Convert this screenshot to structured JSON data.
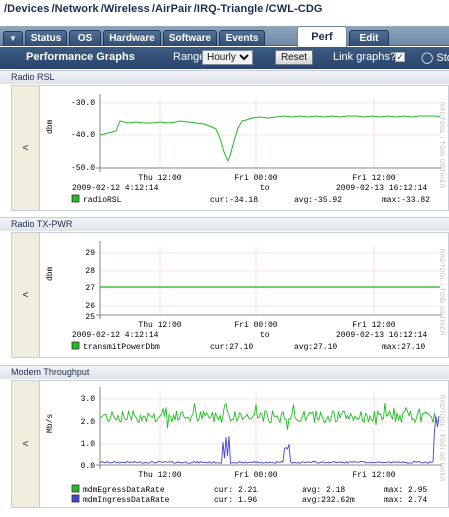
{
  "breadcrumb": [
    "/Devices",
    "/Network",
    "/Wireless",
    "/AirPair",
    "/IRQ-Triangle",
    "/CWL-CDG"
  ],
  "tabs": [
    {
      "label": "Status"
    },
    {
      "label": "OS"
    },
    {
      "label": "Hardware"
    },
    {
      "label": "Software"
    },
    {
      "label": "Events"
    },
    {
      "label": "Perf"
    },
    {
      "label": "Edit"
    }
  ],
  "toolbar": {
    "title": "Performance Graphs",
    "range_label": "Range",
    "range_value": "Hourly",
    "reset_label": "Reset",
    "link_label": "Link graphs?",
    "link_checked": "✓",
    "stop_label": "Sto"
  },
  "collapse_label": "<",
  "panels": [
    {
      "title": "Radio RSL",
      "ylabel": "dbm",
      "yticks": [
        "-30.0",
        "-40.0",
        "-50.0"
      ],
      "xticks": [
        "Thu 12:00",
        "Fri 00:00",
        "Fri 12:00"
      ],
      "start": "2009-02-12 4:12:14",
      "to": "to",
      "end": "2009-02-13 16:12:14",
      "series": [
        {
          "name": "radioRSL",
          "cur": "cur:-34.18",
          "avg": "avg:-35.92",
          "max": "max:-33.82",
          "color": "#22bb22"
        }
      ]
    },
    {
      "title": "Radio TX-PWR",
      "ylabel": "dbm",
      "yticks": [
        "29",
        "28",
        "27",
        "26",
        "25"
      ],
      "xticks": [
        "Thu 12:00",
        "Fri 00:00",
        "Fri 12:00"
      ],
      "start": "2009-02-12 4:12:14",
      "to": "to",
      "end": "2009-02-13 16:12:14",
      "series": [
        {
          "name": "transmitPowerDbm",
          "cur": "cur:27.10",
          "avg": "avg:27.10",
          "max": "max:27.10",
          "color": "#22bb22"
        }
      ]
    },
    {
      "title": "Modem Throughput",
      "ylabel": "Mb/s",
      "yticks": [
        "3.0",
        "2.0",
        "1.0",
        "0.0"
      ],
      "xticks": [
        "Thu 12:00",
        "Fri 00:00",
        "Fri 12:00"
      ],
      "series": [
        {
          "name": "mdmEgressDataRate",
          "cur": "cur: 2.21",
          "avg": "avg: 2.18",
          "max": "max: 2.95",
          "color": "#22bb22"
        },
        {
          "name": "mdmIngressDataRate",
          "cur": "cur: 1.96",
          "avg": "avg:232.62m",
          "max": "max: 2.74",
          "color": "#4444cc"
        }
      ]
    }
  ],
  "watermark": "RRDTOOL / TOBI OETIKER",
  "chart_data": [
    {
      "type": "line",
      "title": "Radio RSL",
      "ylabel": "dbm",
      "ylim": [
        -50,
        -30
      ],
      "x": [
        "Thu 12:00",
        "Fri 00:00",
        "Fri 12:00"
      ],
      "series": [
        {
          "name": "radioRSL",
          "values": [
            -39.5,
            -37.0,
            -36.5,
            -36.0,
            -38.5,
            -47.0,
            -34.5,
            -34.2,
            -34.0,
            -34.1,
            -34.0,
            -34.2,
            -34.0,
            -34.18
          ]
        }
      ]
    },
    {
      "type": "line",
      "title": "Radio TX-PWR",
      "ylabel": "dbm",
      "ylim": [
        25,
        29
      ],
      "x": [
        "Thu 12:00",
        "Fri 00:00",
        "Fri 12:00"
      ],
      "series": [
        {
          "name": "transmitPowerDbm",
          "values": [
            27.1,
            27.1,
            27.1,
            27.1,
            27.1,
            27.1
          ]
        }
      ]
    },
    {
      "type": "line",
      "title": "Modem Throughput",
      "ylabel": "Mb/s",
      "ylim": [
        0,
        3
      ],
      "x": [
        "Thu 12:00",
        "Fri 00:00",
        "Fri 12:00"
      ],
      "series": [
        {
          "name": "mdmEgressDataRate",
          "values": [
            2.2,
            2.3,
            2.1,
            2.4,
            2.2,
            2.3,
            2.1,
            2.2,
            2.3,
            2.2,
            2.4,
            2.2,
            2.21
          ]
        },
        {
          "name": "mdmIngressDataRate",
          "values": [
            0.1,
            0.1,
            0.1,
            0.1,
            0.1,
            1.9,
            0.1,
            0.1,
            0.1,
            0.1,
            0.1,
            0.1,
            1.96
          ]
        }
      ]
    }
  ]
}
